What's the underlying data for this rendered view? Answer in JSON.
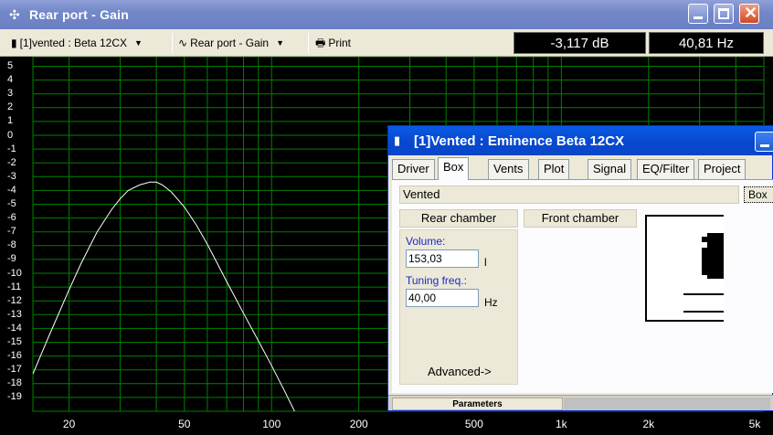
{
  "window": {
    "title": "Rear port - Gain",
    "icon": "crosshair-icon"
  },
  "toolbar": {
    "driver_select": "[1]vented : Beta 12CX",
    "plot_select": "Rear port - Gain",
    "print_label": "Print",
    "readout_db": "-3,117 dB",
    "readout_hz": "40,81 Hz"
  },
  "chart_data": {
    "type": "line",
    "title": "",
    "xlabel": "",
    "ylabel": "",
    "x_scale": "log",
    "xlim": [
      15,
      5000
    ],
    "ylim": [
      -19,
      5
    ],
    "x_tick_labels": [
      "20",
      "50",
      "100",
      "200",
      "500",
      "1k",
      "2k",
      "5k"
    ],
    "x_tick_values": [
      20,
      50,
      100,
      200,
      500,
      1000,
      2000,
      5000
    ],
    "y_tick_labels": [
      "5",
      "4",
      "3",
      "2",
      "1",
      "0",
      "-1",
      "-2",
      "-3",
      "-4",
      "-5",
      "-6",
      "-7",
      "-8",
      "-9",
      "-10",
      "-11",
      "-12",
      "-13",
      "-14",
      "-15",
      "-16",
      "-17",
      "-18",
      "-19"
    ],
    "grid": true,
    "grid_color": "#008000",
    "line_color": "#ffffff",
    "series": [
      {
        "x": [
          15,
          17,
          20,
          22,
          25,
          28,
          30,
          32,
          35,
          38,
          40,
          42,
          45,
          50,
          55,
          60,
          65,
          70,
          80,
          90,
          100,
          110,
          120
        ],
        "y": [
          -17.3,
          -14.6,
          -11.2,
          -9.3,
          -7.0,
          -5.4,
          -4.6,
          -4.0,
          -3.6,
          -3.4,
          -3.4,
          -3.6,
          -4.1,
          -5.2,
          -6.5,
          -7.9,
          -9.3,
          -10.6,
          -12.9,
          -14.9,
          -16.7,
          -18.4,
          -20
        ]
      }
    ]
  },
  "dialog": {
    "title": "[1]Vented : Eminence  Beta 12CX",
    "icon": "speaker-icon",
    "tabs": [
      "Driver",
      "Box",
      "Vents",
      "Plot",
      "Signal",
      "EQ/Filter",
      "Project"
    ],
    "active_tab": "Box",
    "box_type": "Vented",
    "box_button": "Box",
    "rear_chamber_label": "Rear chamber",
    "front_chamber_label": "Front chamber",
    "volume_label": "Volume:",
    "volume_value": "153,03",
    "volume_unit": "l",
    "tuning_label": "Tuning freq.:",
    "tuning_value": "40,00",
    "tuning_unit": "Hz",
    "advanced_label": "Advanced->",
    "status_label": "Parameters"
  }
}
